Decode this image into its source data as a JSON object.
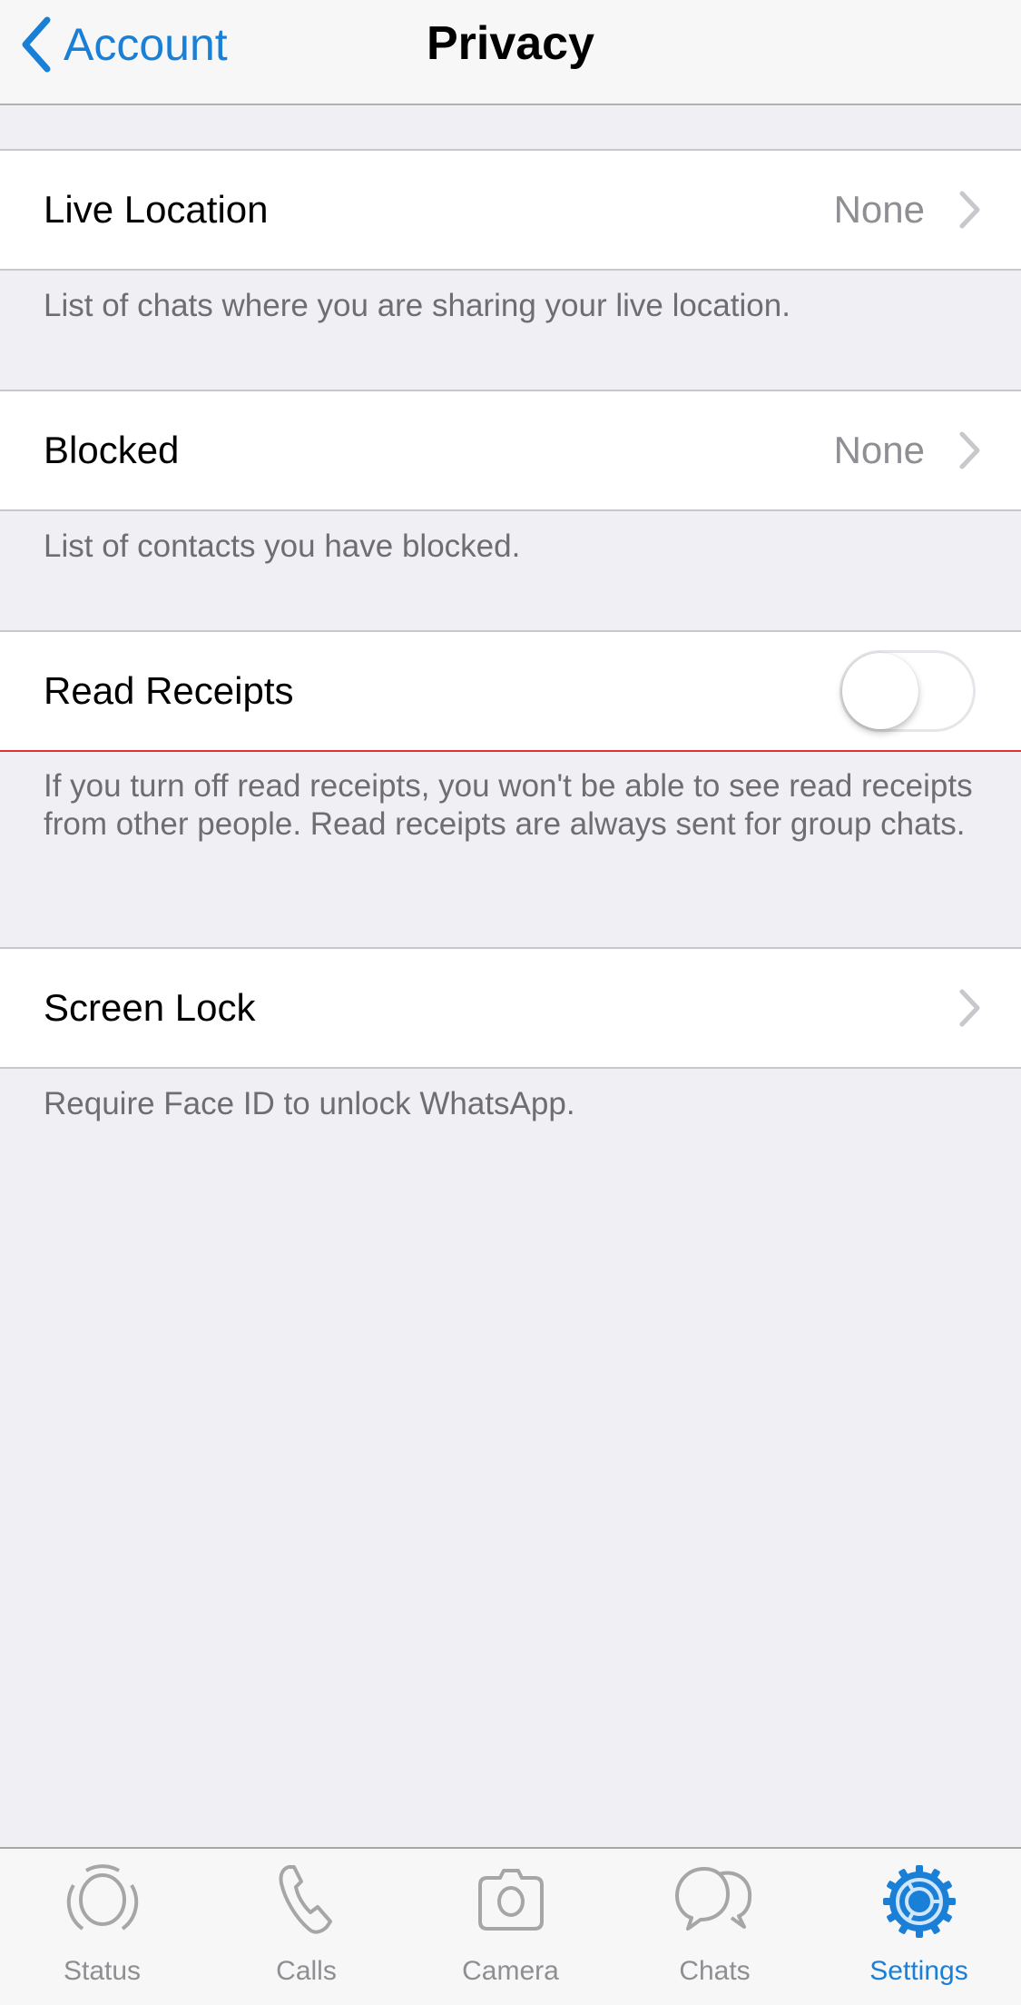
{
  "navbar": {
    "back_label": "Account",
    "title": "Privacy"
  },
  "sections": [
    {
      "label": "Live Location",
      "value": "None",
      "footer": "List of chats where you are sharing your live location."
    },
    {
      "label": "Blocked",
      "value": "None",
      "footer": "List of contacts you have blocked."
    },
    {
      "label": "Read Receipts",
      "toggle_on": false,
      "footer": "If you turn off read receipts, you won't be able to see read receipts from other people. Read receipts are always sent for group chats."
    },
    {
      "label": "Screen Lock",
      "footer": "Require Face ID to unlock WhatsApp."
    }
  ],
  "tabbar": {
    "active": "Settings",
    "tabs": [
      {
        "label": "Status",
        "icon": "status-icon"
      },
      {
        "label": "Calls",
        "icon": "phone-icon"
      },
      {
        "label": "Camera",
        "icon": "camera-icon"
      },
      {
        "label": "Chats",
        "icon": "chat-bubbles-icon"
      },
      {
        "label": "Settings",
        "icon": "gear-icon"
      }
    ]
  },
  "colors": {
    "accent": "#1a7fd6",
    "inactive": "#8e8e93",
    "background": "#efeff4"
  }
}
